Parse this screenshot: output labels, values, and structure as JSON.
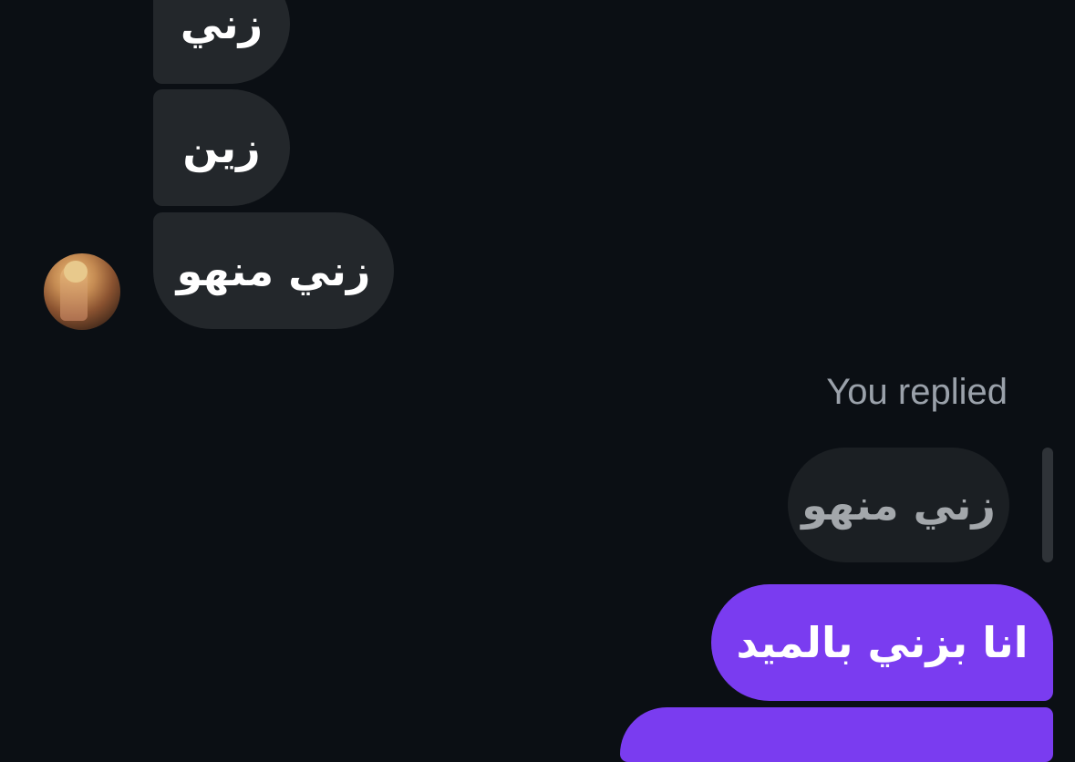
{
  "conversation": {
    "incoming_messages": [
      {
        "text": "زني"
      },
      {
        "text": "زين"
      },
      {
        "text": "زني منهو"
      }
    ],
    "reply_label": "You replied",
    "quoted_message": "زني منهو",
    "outgoing_messages": [
      {
        "text": "انا بزني بالميد"
      },
      {
        "text": ""
      }
    ]
  },
  "colors": {
    "background": "#0b0f14",
    "incoming_bubble": "#23272b",
    "quoted_bubble": "#1b1f23",
    "outgoing_bubble": "#7a3cf0",
    "reply_label_text": "#9aa1aa"
  },
  "icons": {
    "avatar": "contact-avatar-photo"
  }
}
